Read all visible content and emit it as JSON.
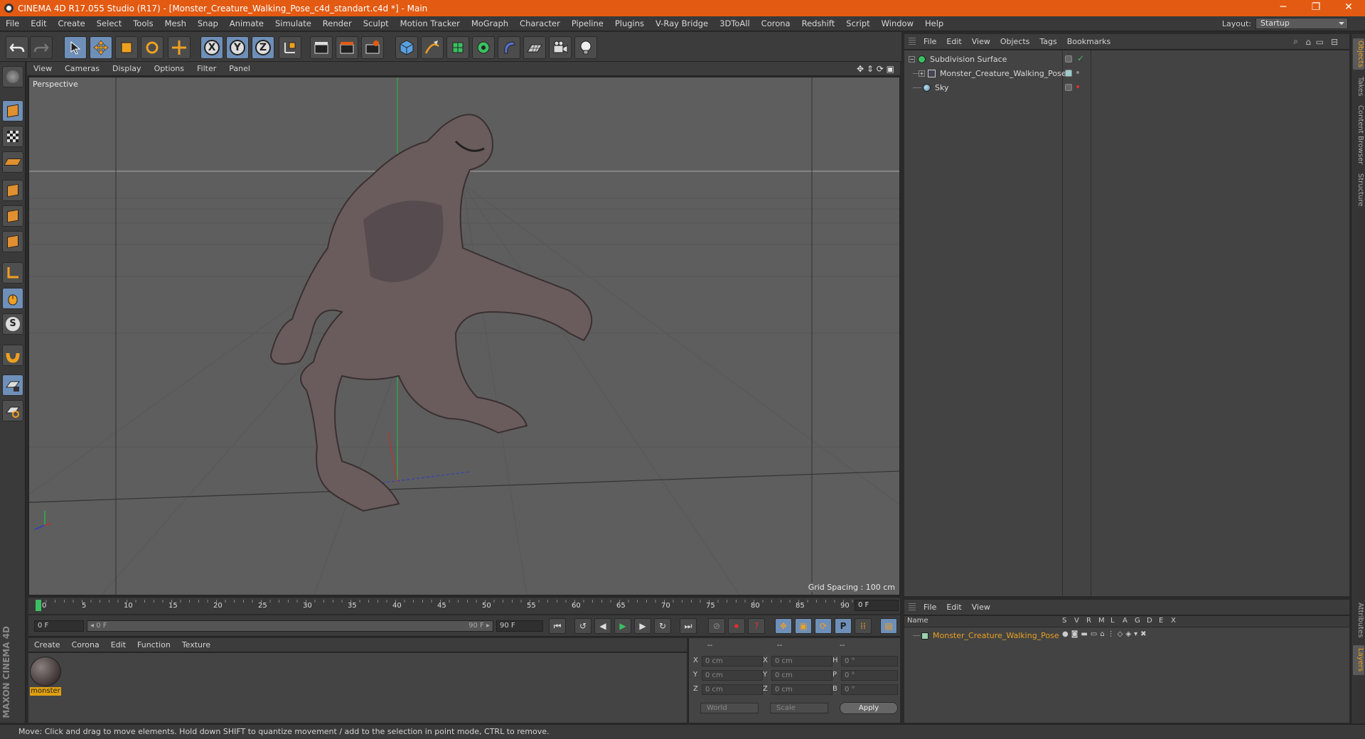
{
  "window": {
    "title": "CINEMA 4D R17.055 Studio (R17) - [Monster_Creature_Walking_Pose_c4d_standart.c4d *] - Main",
    "minimize": "─",
    "restore": "❐",
    "close": "✕"
  },
  "menu": [
    "File",
    "Edit",
    "Create",
    "Select",
    "Tools",
    "Mesh",
    "Snap",
    "Animate",
    "Simulate",
    "Render",
    "Sculpt",
    "Motion Tracker",
    "MoGraph",
    "Character",
    "Pipeline",
    "Plugins",
    "V-Ray Bridge",
    "3DToAll",
    "Corona",
    "Redshift",
    "Script",
    "Window",
    "Help"
  ],
  "layout": {
    "label": "Layout:",
    "value": "Startup"
  },
  "axes": [
    "X",
    "Y",
    "Z"
  ],
  "viewport": {
    "menu": [
      "View",
      "Cameras",
      "Display",
      "Options",
      "Filter",
      "Panel"
    ],
    "label": "Perspective",
    "grid_spacing": "Grid Spacing : 100 cm"
  },
  "timeline": {
    "ticks": [
      "0",
      "5",
      "10",
      "15",
      "20",
      "25",
      "30",
      "35",
      "40",
      "45",
      "50",
      "55",
      "60",
      "65",
      "70",
      "75",
      "80",
      "85",
      "90"
    ],
    "current_frame": "0 F",
    "start_field": "0 F",
    "range_start": "◂ 0 F",
    "range_end": "90 F ▸",
    "end_field": "90 F"
  },
  "material_manager": {
    "menu": [
      "Create",
      "Corona",
      "Edit",
      "Function",
      "Texture"
    ],
    "materials": [
      {
        "name": "monster"
      }
    ]
  },
  "coordinates": {
    "header": [
      "--",
      "--",
      "--"
    ],
    "rows": [
      {
        "axis1": "X",
        "val1": "0 cm",
        "axis2": "X",
        "val2": "0 cm",
        "axis3": "H",
        "val3": "0 °"
      },
      {
        "axis1": "Y",
        "val1": "0 cm",
        "axis2": "Y",
        "val2": "0 cm",
        "axis3": "P",
        "val3": "0 °"
      },
      {
        "axis1": "Z",
        "val1": "0 cm",
        "axis2": "Z",
        "val2": "0 cm",
        "axis3": "B",
        "val3": "0 °"
      }
    ],
    "space": "World",
    "mode": "Scale",
    "apply": "Apply"
  },
  "object_manager": {
    "menu": [
      "File",
      "Edit",
      "View",
      "Objects",
      "Tags",
      "Bookmarks"
    ],
    "objects": [
      {
        "name": "Subdivision Surface"
      },
      {
        "name": "Monster_Creature_Walking_Pose"
      },
      {
        "name": "Sky"
      }
    ]
  },
  "layer_manager": {
    "menu": [
      "File",
      "Edit",
      "View"
    ],
    "columns": [
      "Name",
      "S",
      "V",
      "R",
      "M",
      "L",
      "A",
      "G",
      "D",
      "E",
      "X"
    ],
    "layers": [
      {
        "name": "Monster_Creature_Walking_Pose",
        "color": "#e8a020"
      }
    ]
  },
  "side_tabs": [
    "Objects",
    "Takes",
    "Content Browser",
    "Structure",
    "Attributes",
    "Layers"
  ],
  "brand": "MAXON CINEMA 4D",
  "status": "Move: Click and drag to move elements. Hold down SHIFT to quantize movement / add to the selection in point mode, CTRL to remove.",
  "colors": {
    "accent": "#e35a12",
    "selected": "#6e8fb8",
    "layer": "#e8a020"
  }
}
